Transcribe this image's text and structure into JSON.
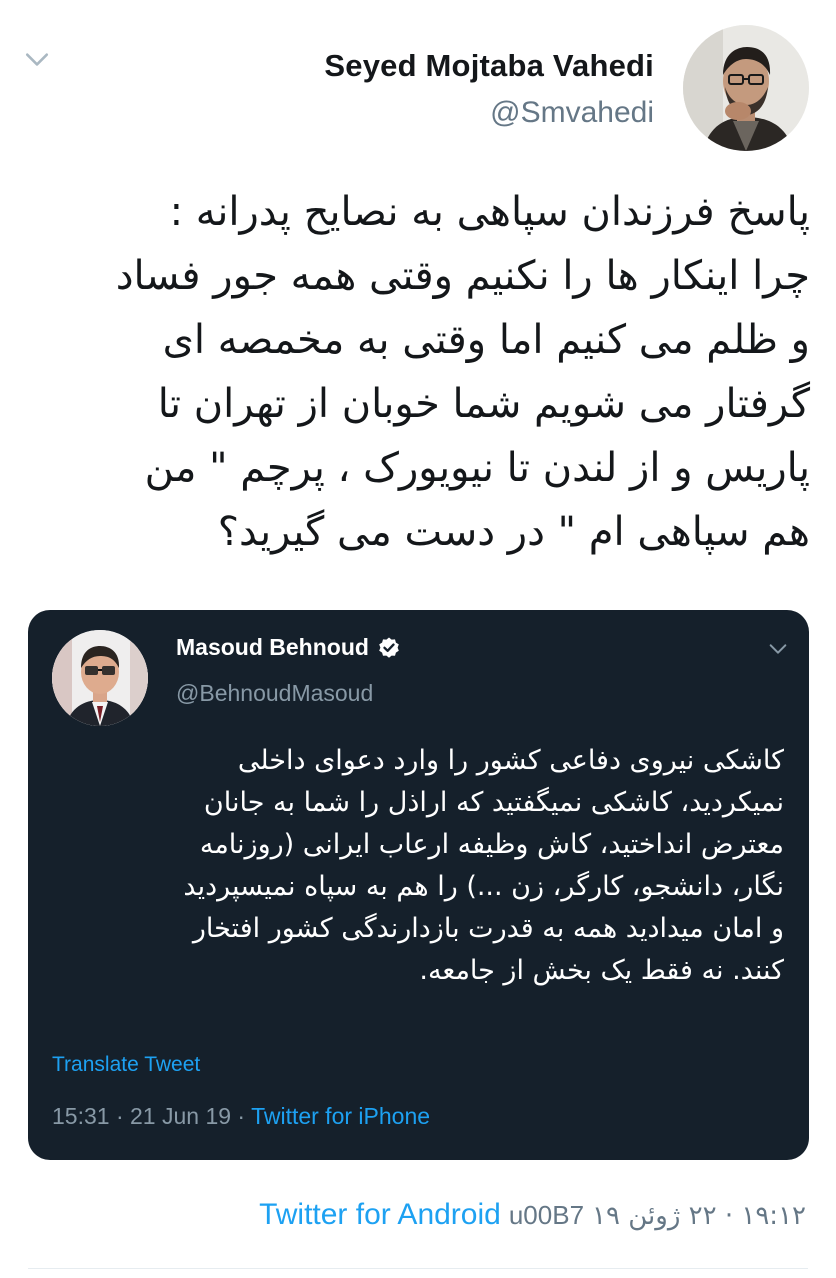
{
  "tweet": {
    "author_name": "Seyed Mojtaba Vahedi",
    "author_handle": "@Smvahedi",
    "text_lines": [
      "پاسخ فرزندان سپاهی به نصایح پدرانه :",
      "چرا اینکار ها را نکنیم وقتی همه جور فساد",
      "و ظلم می کنیم اما وقتی به مخمصه ای",
      "گرفتار می شویم  شما خوبان از تهران تا",
      "پاریس و از لندن تا نیویورک ، پرچم \" من",
      "هم سپاهی ام \" در دست می گیرید؟"
    ],
    "timestamp": "۱۹:۱۲ · ۲۲ ژوئن ۱۹",
    "separator": "u00B7",
    "source": "Twitter for Android",
    "icons": {
      "menu": "chevron-down-icon",
      "avatar": "avatar-photo"
    }
  },
  "quoted_tweet": {
    "author_name": "Masoud Behnoud",
    "author_handle": "@BehnoudMasoud",
    "verified": true,
    "text_lines": [
      "کاشکی نیروی دفاعی کشور را وارد دعوای داخلی",
      "نمیکردید، کاشکی نمیگفتید که اراذل را شما به جانان",
      "معترض انداختید، کاش وظیفه ارعاب ایرانی (روزنامه",
      "نگار، دانشجو، کارگر، زن ...) را هم به سپاه نمیسپردید",
      "و امان میدادید همه به قدرت بازدارندگی کشور افتخار",
      "کنند. نه فقط یک بخش از جامعه."
    ],
    "translate_label": "Translate Tweet",
    "timestamp": "15:31 · 21 Jun 19",
    "meta_separator": " · ",
    "source": "Twitter for iPhone",
    "colors": {
      "background": "#15202b",
      "link": "#1da1f2",
      "muted": "#8899a6"
    }
  }
}
